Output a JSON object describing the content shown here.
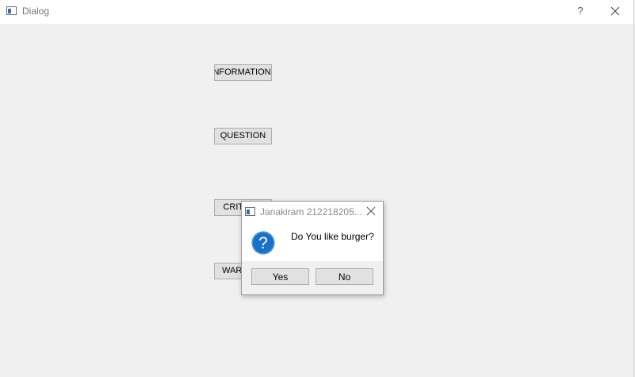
{
  "window": {
    "title": "Dialog",
    "help_label": "?"
  },
  "buttons": {
    "information": "INFORMATION",
    "question": "QUESTION",
    "critical": "CRITICAL",
    "warning": "WARNING"
  },
  "message_box": {
    "title": "Janakiram 212218205...",
    "text": "Do You like burger?",
    "icon": "question-icon",
    "yes_label": "Yes",
    "no_label": "No"
  },
  "colors": {
    "question_icon": "#1a6fc6",
    "window_bg": "#f0f0f0",
    "button_bg": "#e1e1e1"
  }
}
